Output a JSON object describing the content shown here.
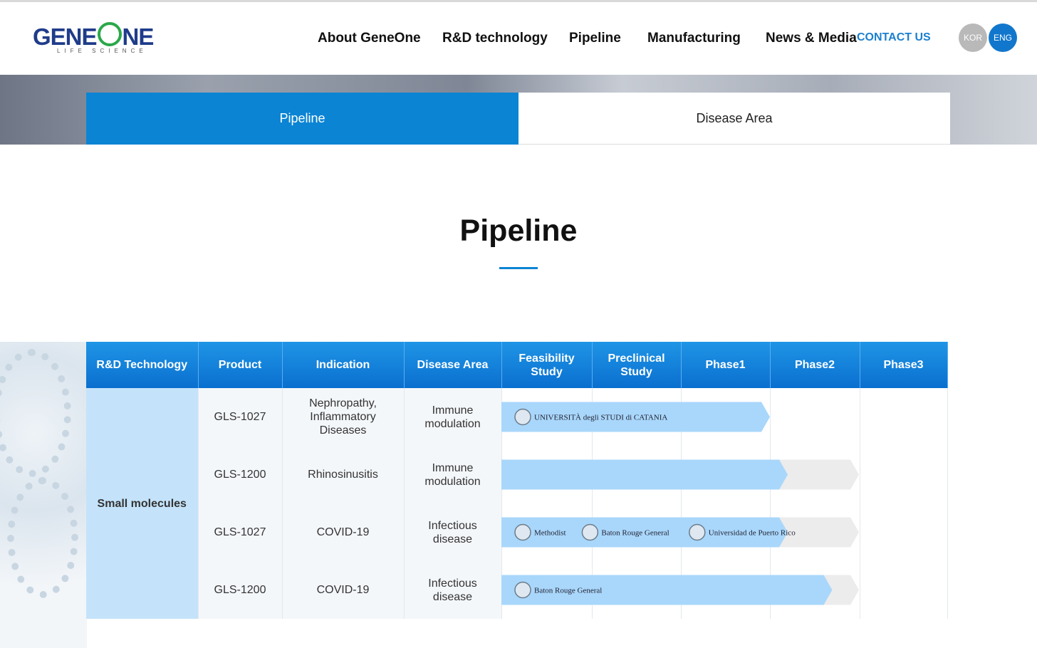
{
  "brand": {
    "name_pre": "GENE",
    "name_post": "NE",
    "sub": "LIFE SCIENCE",
    "primary": "#1f3c8a",
    "accent": "#2aa84a"
  },
  "nav": {
    "items": [
      "About GeneOne",
      "R&D technology",
      "Pipeline",
      "Manufacturing",
      "News & Media"
    ],
    "contact": "CONTACT US",
    "langs": [
      "KOR",
      "ENG"
    ]
  },
  "tabs": [
    {
      "label": "Pipeline",
      "active": true
    },
    {
      "label": "Disease Area",
      "active": false
    }
  ],
  "page_title": "Pipeline",
  "colors": {
    "tab_active": "#0b84d4",
    "bar": "#a9d7fb",
    "bar_tail": "#ececec"
  },
  "table": {
    "headers": [
      "R&D Technology",
      "Product",
      "Indication",
      "Disease Area",
      "Feasibility Study",
      "Preclinical Study",
      "Phase1",
      "Phase2",
      "Phase3"
    ],
    "technology": "Small molecules",
    "rows": [
      {
        "product": "GLS-1027",
        "indication": "Nephropathy, Inflammatory Diseases",
        "disease": "Immune modulation",
        "progress": 3,
        "tail": 0,
        "partners": [
          "UNIVERSITÀ degli STUDI di CATANIA"
        ]
      },
      {
        "product": "GLS-1200",
        "indication": "Rhinosinusitis",
        "disease": "Immune modulation",
        "progress": 3.2,
        "tail": 4,
        "partners": []
      },
      {
        "product": "GLS-1027",
        "indication": "COVID-19",
        "disease": "Infectious disease",
        "progress": 3.2,
        "tail": 4,
        "partners": [
          "Methodist",
          "Baton Rouge General",
          "Universidad de Puerto Rico"
        ]
      },
      {
        "product": "GLS-1200",
        "indication": "COVID-19",
        "disease": "Infectious disease",
        "progress": 3.7,
        "tail": 4,
        "partners": [
          "Baton Rouge General"
        ]
      }
    ]
  }
}
